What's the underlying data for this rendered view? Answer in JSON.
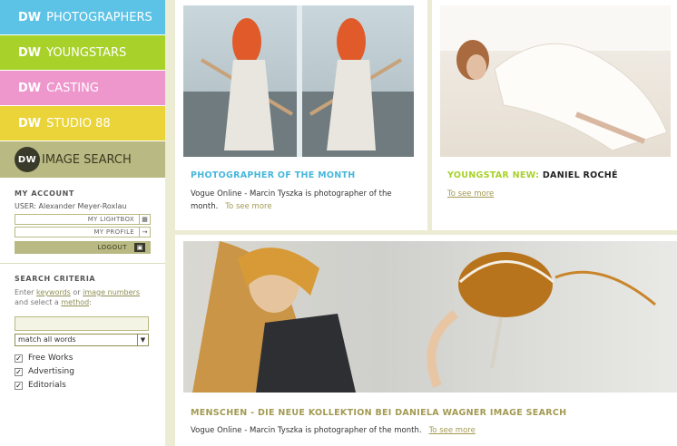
{
  "nav": {
    "items": [
      {
        "prefix": "DW",
        "label": "PHOTOGRAPHERS"
      },
      {
        "prefix": "DW",
        "label": "YOUNGSTARS"
      },
      {
        "prefix": "DW",
        "label": "CASTING"
      },
      {
        "prefix": "DW",
        "label": "STUDIO 88"
      },
      {
        "prefix": "DW",
        "label": "IMAGE SEARCH"
      }
    ]
  },
  "account": {
    "title": "MY ACCOUNT",
    "user": "USER: Alexander Meyer-Roxlau",
    "lightbox_label": "MY LIGHTBOX",
    "profile_label": "MY PROFILE",
    "logout_label": "LOGOUT"
  },
  "search": {
    "title": "SEARCH CRITERIA",
    "help_pre": "Enter ",
    "help_link1": "keywords",
    "help_mid": " or ",
    "help_link2": "image numbers",
    "help_mid2": " and select a ",
    "help_link3": "method",
    "help_end": ":",
    "input_value": "",
    "method_selected": "match all words",
    "filters": [
      {
        "label": "Free Works",
        "checked": true
      },
      {
        "label": "Advertising",
        "checked": true
      },
      {
        "label": "Editorials",
        "checked": true
      }
    ]
  },
  "cards": {
    "photographer": {
      "title": "PHOTOGRAPHER OF THE MONTH",
      "text": "Vogue Online - Marcin Tyszka is photographer of the month.",
      "more": "To see more"
    },
    "youngstar": {
      "title_prefix": "YOUNGSTAR NEW:",
      "title_name": "DANIEL ROCHÉ",
      "more": "To see more"
    },
    "collection": {
      "title": "MENSCHEN - DIE NEUE KOLLEKTION BEI DANIELA WAGNER IMAGE SEARCH",
      "text": "Vogue Online - Marcin Tyszka is photographer of the month.",
      "more": "To see more"
    }
  },
  "colors": {
    "photographers": "#5cc3e6",
    "youngstars": "#a8d12a",
    "casting": "#ee97cd",
    "studio": "#ead43a",
    "image_search": "#b9b983",
    "accent_gold": "#a39a52"
  }
}
